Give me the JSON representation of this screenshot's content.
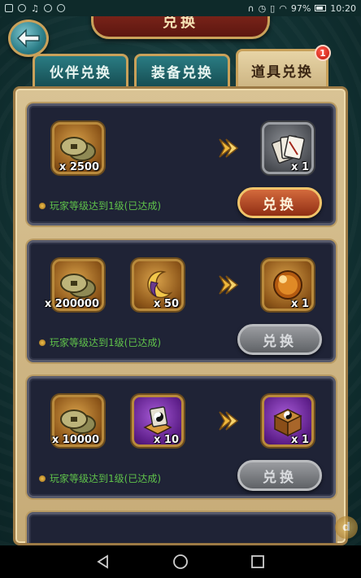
{
  "status_bar": {
    "battery": "97%",
    "time": "10:20"
  },
  "header": {
    "title": "兑换"
  },
  "tabs": [
    {
      "label": "伙伴兑换",
      "active": false
    },
    {
      "label": "装备兑换",
      "active": false
    },
    {
      "label": "道具兑换",
      "active": true,
      "badge": "1"
    }
  ],
  "exchanges": [
    {
      "costs": [
        {
          "icon": "copper-coins-icon",
          "quantity": "x 2500"
        }
      ],
      "reward": {
        "icon": "cards-icon",
        "quantity": "x 1"
      },
      "requirement": "玩家等级达到1级(已达成)",
      "button_label": "兑换",
      "button_enabled": true
    },
    {
      "costs": [
        {
          "icon": "copper-coins-icon",
          "quantity": "x 200000"
        },
        {
          "icon": "crescent-moon-icon",
          "quantity": "x 50"
        }
      ],
      "reward": {
        "icon": "golden-orb-icon",
        "quantity": "x 1"
      },
      "requirement": "玩家等级达到1级(已达成)",
      "button_label": "兑换",
      "button_enabled": false
    },
    {
      "costs": [
        {
          "icon": "copper-coins-icon",
          "quantity": "x 10000"
        },
        {
          "icon": "yin-yang-token-icon",
          "quantity": "x 10"
        }
      ],
      "reward": {
        "icon": "yin-yang-chest-icon",
        "quantity": "x 1"
      },
      "requirement": "玩家等级达到1级(已达成)",
      "button_label": "兑换",
      "button_enabled": false
    }
  ],
  "colors": {
    "requirement_text": "#5fc24a",
    "active_button": "#b0431f",
    "disabled_button": "#7a7c80",
    "badge": "#d8241a"
  }
}
